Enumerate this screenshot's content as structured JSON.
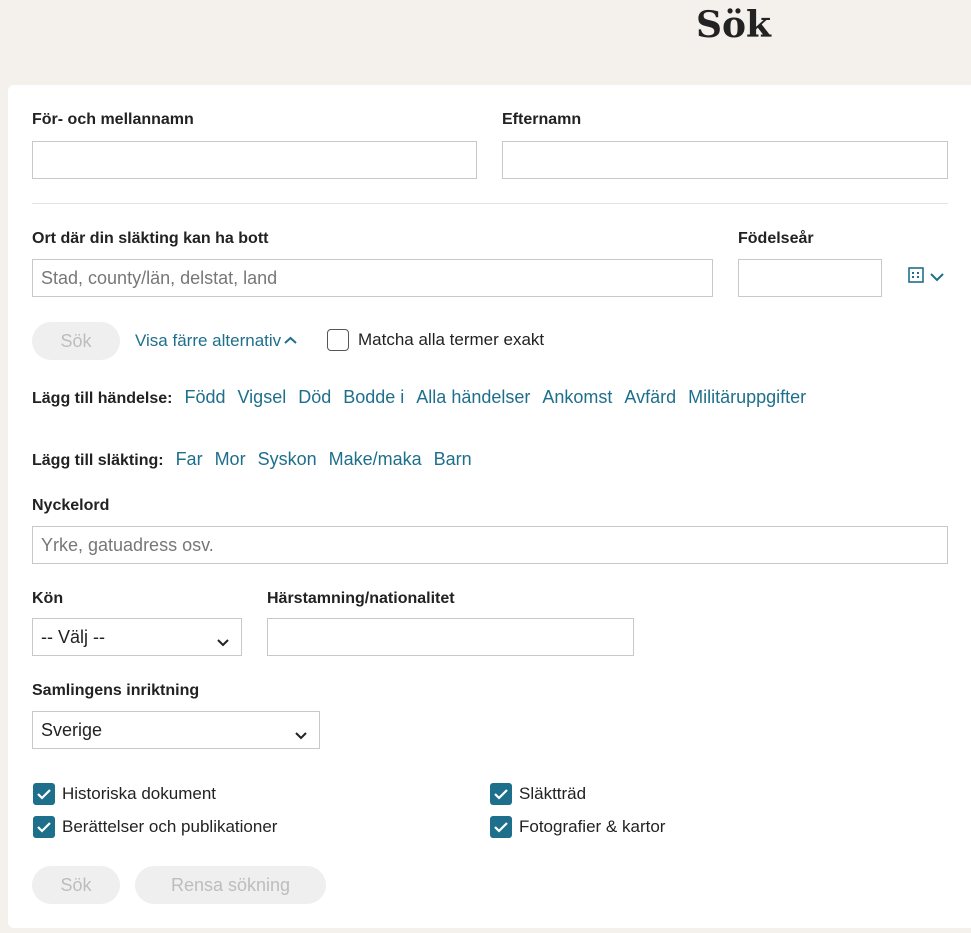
{
  "page": {
    "title": "Sök"
  },
  "name": {
    "first_label": "För- och mellannamn",
    "first_value": "",
    "last_label": "Efternamn",
    "last_value": ""
  },
  "place": {
    "label": "Ort där din släkting kan ha bott",
    "placeholder": "Stad, county/län, delstat, land"
  },
  "birth": {
    "label": "Födelseår",
    "value": ""
  },
  "actions": {
    "search_label": "Sök",
    "toggle_label": "Visa färre alternativ",
    "exact_label": "Matcha alla termer exakt",
    "exact_checked": false,
    "clear_label": "Rensa sökning"
  },
  "events": {
    "label": "Lägg till händelse:",
    "items": [
      "Född",
      "Vigsel",
      "Död",
      "Bodde i",
      "Alla händelser",
      "Ankomst",
      "Avfärd",
      "Militäruppgifter"
    ]
  },
  "relatives": {
    "label": "Lägg till släkting:",
    "items": [
      "Far",
      "Mor",
      "Syskon",
      "Make/maka",
      "Barn"
    ]
  },
  "keyword": {
    "label": "Nyckelord",
    "placeholder": "Yrke, gatuadress osv."
  },
  "gender": {
    "label": "Kön",
    "selected": "-- Välj --"
  },
  "ethnicity": {
    "label": "Härstamning/nationalitet",
    "value": ""
  },
  "collection": {
    "label": "Samlingens inriktning",
    "selected": "Sverige"
  },
  "categories": [
    {
      "label": "Historiska dokument",
      "checked": true
    },
    {
      "label": "Släktträd",
      "checked": true
    },
    {
      "label": "Berättelser och publikationer",
      "checked": true
    },
    {
      "label": "Fotografier & kartor",
      "checked": true
    }
  ],
  "colors": {
    "accent": "#1e6f8c",
    "page_bg": "#f4f1ec",
    "disabled_bg": "#efefef",
    "disabled_text": "#bdbdbd"
  },
  "icons": {
    "date_format": "calendar-icon",
    "dropdown": "chevron-down-icon",
    "checkbox": "checkmark-icon"
  }
}
